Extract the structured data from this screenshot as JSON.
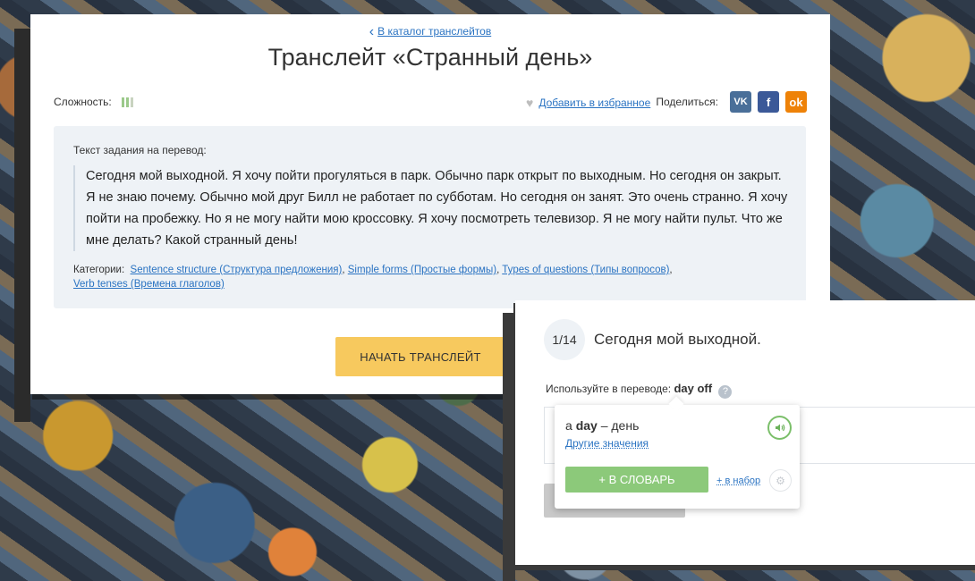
{
  "header": {
    "back_link": "В каталог транслейтов",
    "title": "Транслейт «Странный день»"
  },
  "meta": {
    "difficulty_label": "Сложность:",
    "difficulty_level": "2 of 3",
    "favorite_label": "Добавить в избранное",
    "share_label": "Поделиться:",
    "social": {
      "vk": "VK",
      "fb": "f",
      "ok": "ok"
    }
  },
  "task": {
    "label": "Текст задания на перевод:",
    "text": "Сегодня мой выходной. Я хочу пойти прогуляться в парк. Обычно парк открыт по выходным. Но сегодня он закрыт. Я не знаю почему. Обычно мой друг Билл не работает по субботам. Но сегодня он занят. Это очень странно. Я хочу пойти на пробежку. Но я не могу найти мою кроссовку. Я хочу посмотреть телевизор. Я не могу найти пульт. Что же мне делать? Какой странный день!",
    "categories_label": "Категории:",
    "categories": [
      "Sentence structure (Структура предложения)",
      "Simple forms (Простые формы)",
      "Types of questions (Типы вопросов)",
      "Verb tenses (Времена глаголов)"
    ]
  },
  "start_button": "НАЧАТЬ ТРАНСЛЕЙТ",
  "exercise": {
    "step": "1/14",
    "sentence": "Сегодня мой выходной.",
    "hint_label": "Используйте в переводе:",
    "hint_phrase": "day off",
    "help_icon": "?"
  },
  "popover": {
    "article": "a",
    "word": "day",
    "translation": "– день",
    "other_meanings": "Другие значения",
    "dict_button": "+ В СЛОВАРЬ",
    "set_link": "+ в набор"
  },
  "colors": {
    "link": "#2a73c2",
    "start_button": "#f7c95e",
    "dict_button": "#8cc97a",
    "task_bg": "#eef2f6"
  }
}
